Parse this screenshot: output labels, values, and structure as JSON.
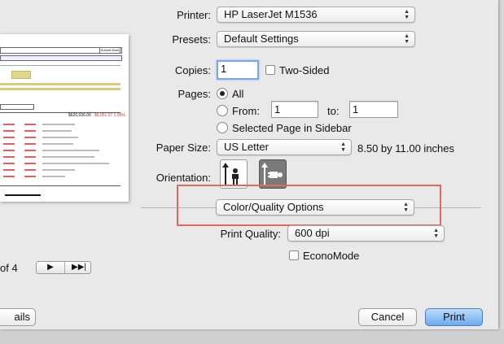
{
  "print_dialog": {
    "printer": {
      "label": "Printer:",
      "value": "HP LaserJet M1536"
    },
    "presets": {
      "label": "Presets:",
      "value": "Default Settings"
    },
    "copies": {
      "label": "Copies:",
      "value": "1",
      "two_sided_label": "Two-Sided"
    },
    "pages": {
      "label": "Pages:",
      "all_label": "All",
      "from_label": "From:",
      "from_value": "1",
      "to_label": "to:",
      "to_value": "1",
      "selected_label": "Selected Page in Sidebar"
    },
    "paper_size": {
      "label": "Paper Size:",
      "value": "US Letter",
      "dimensions": "8.50 by 11.00 inches"
    },
    "orientation": {
      "label": "Orientation:"
    },
    "section_popup": {
      "value": "Color/Quality Options"
    },
    "print_quality": {
      "label": "Print Quality:",
      "value": "600 dpi"
    },
    "economode_label": "EconoMode",
    "cancel_label": "Cancel",
    "print_label": "Print",
    "details_label": "ails",
    "page_count_label": "of 4"
  },
  "preview_page": {
    "header_box_label": "Submit Work",
    "total_value": "$620,036.00",
    "red_total": "$6,051.07 1.05%"
  },
  "colors": {
    "highlight": "#e06a60",
    "default_button": "#6aaaf0",
    "focus_ring": "#7aa7e8"
  }
}
